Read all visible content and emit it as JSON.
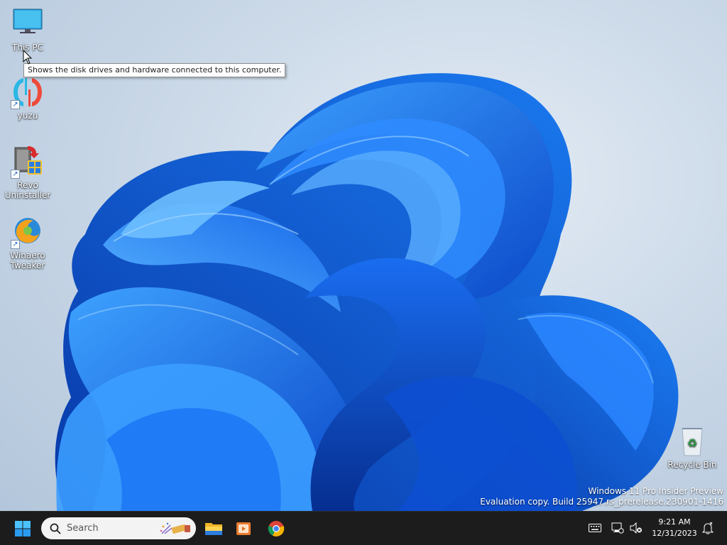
{
  "desktop": {
    "icons": [
      {
        "label": "This PC",
        "name": "this-pc"
      },
      {
        "label": "yuzu",
        "name": "yuzu"
      },
      {
        "label": "Revo Uninstaller",
        "name": "revo-uninstaller"
      },
      {
        "label": "Winaero Tweaker",
        "name": "winaero-tweaker"
      },
      {
        "label": "Recycle Bin",
        "name": "recycle-bin"
      }
    ],
    "tooltip": "Shows the disk drives and hardware connected to this computer.",
    "watermark": {
      "line1": "Windows 11 Pro Insider Preview",
      "line2": "Evaluation copy. Build 25947.rs_prerelease.230901-1416"
    }
  },
  "taskbar": {
    "search_placeholder": "Search",
    "pinned": [
      "start-icon",
      "file-explorer-icon",
      "media-player-icon",
      "chrome-icon"
    ],
    "tray": [
      "keyboard-icon",
      "network-icon",
      "volume-muted-icon",
      "notification-icon"
    ],
    "clock": {
      "time": "9:21 AM",
      "date": "12/31/2023"
    }
  },
  "colors": {
    "accent": "#1a73e8",
    "taskbar_bg": "#1c1c1c",
    "wallpaper_bg": "#cbd9e8",
    "bloom_blue": "#0f5fe0"
  }
}
